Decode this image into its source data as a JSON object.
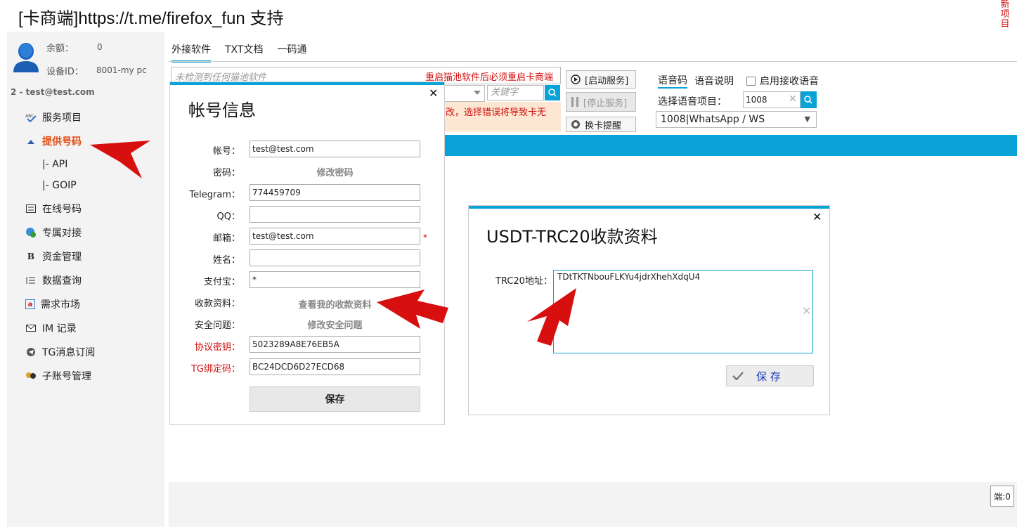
{
  "app": {
    "title": "[卡商端]https://t.me/firefox_fun 支持",
    "new_project": "新项目"
  },
  "sidebar": {
    "balance_label": "余额：",
    "balance_value": "0",
    "device_label": "设备ID：",
    "device_value": "8001-my pc",
    "account_line": "2 - test@test.com",
    "items": [
      {
        "label": "服务项目",
        "icon": "abc-icon"
      },
      {
        "label": "提供号码",
        "icon": "up-arrow-icon",
        "active": true
      },
      {
        "label": "|- API"
      },
      {
        "label": "|- GOIP"
      },
      {
        "label": "在线号码",
        "icon": "list-icon"
      },
      {
        "label": "专属对接",
        "icon": "globe-user-icon"
      },
      {
        "label": "资金管理",
        "icon": "b-icon"
      },
      {
        "label": "数据查询",
        "icon": "numbered-list-icon"
      },
      {
        "label": "需求市场",
        "icon": "a-icon"
      },
      {
        "label": "IM 记录",
        "icon": "mail-icon"
      },
      {
        "label": "TG消息订阅",
        "icon": "telegram-icon"
      },
      {
        "label": "子账号管理",
        "icon": "users-icon"
      }
    ]
  },
  "main": {
    "tabs": [
      {
        "label": "外接软件"
      },
      {
        "label": "TXT文档"
      },
      {
        "label": "一码通"
      }
    ],
    "detect_placeholder": "未检测到任何猫池软件",
    "detect_warning": "重启猫池软件后必须重启卡商端",
    "keyword_placeholder": "关键字",
    "note_partial": "改，选择错误将导致卡无",
    "start_service": "[启动服务]",
    "stop_service": "[停止服务]",
    "swap_card_alert": "换卡提醒"
  },
  "voice": {
    "tabs": [
      {
        "label": "语音码"
      },
      {
        "label": "语音说明"
      }
    ],
    "enable_label": "启用接收语音",
    "select_label": "选择语音项目：",
    "code_value": "1008",
    "selected_option": "1008|WhatsApp / WS"
  },
  "account_dialog": {
    "title": "帐号信息",
    "fields": {
      "account": {
        "label": "帐号：",
        "value": "test@test.com"
      },
      "password": {
        "label": "密码：",
        "link": "修改密码"
      },
      "telegram": {
        "label": "Telegram：",
        "value": "774459709"
      },
      "qq": {
        "label": "QQ：",
        "value": ""
      },
      "email": {
        "label": "邮箱：",
        "value": "test@test.com",
        "required_mark": "*"
      },
      "name": {
        "label": "姓名：",
        "value": ""
      },
      "alipay": {
        "label": "支付宝：",
        "value": "*"
      },
      "payment_info": {
        "label": "收款资料：",
        "link": "查看我的收款资料"
      },
      "security_q": {
        "label": "安全问题：",
        "link": "修改安全问题"
      },
      "protocol_key": {
        "label": "协议密钥：",
        "value": "5023289A8E76EB5A"
      },
      "tg_bind_code": {
        "label": "TG绑定码：",
        "value": "BC24DCD6D27ECD68"
      }
    },
    "save_label": "保存"
  },
  "usdt_dialog": {
    "title": "USDT-TRC20收款资料",
    "address_label": "TRC20地址：",
    "address_value": "TDtTKTNbouFLKYu4jdrXhehXdqU4",
    "save_label": "保 存"
  },
  "status": {
    "end_label": "端:0"
  },
  "colors": {
    "accent": "#0aa3d8",
    "warning": "#d21010",
    "active_nav": "#e04a10",
    "note_bg": "#fde6d2",
    "annotation_arrow": "#d80f0f"
  }
}
